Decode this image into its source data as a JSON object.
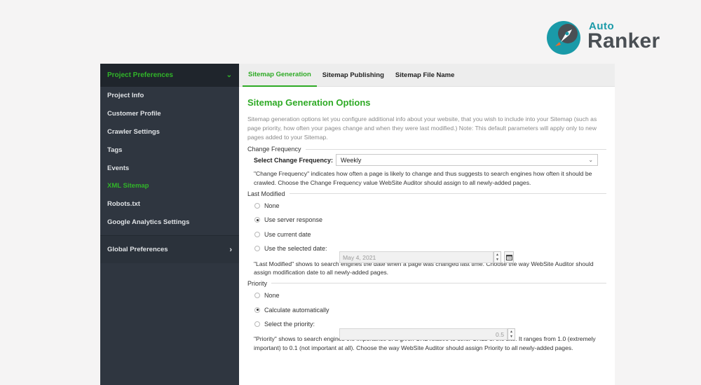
{
  "brand": {
    "line1": "Auto",
    "line2": "Ranker"
  },
  "sidebar": {
    "header": "Project Preferences",
    "items": [
      {
        "label": "Project Info"
      },
      {
        "label": "Customer Profile"
      },
      {
        "label": "Crawler Settings"
      },
      {
        "label": "Tags"
      },
      {
        "label": "Events"
      },
      {
        "label": "XML Sitemap",
        "active": true
      },
      {
        "label": "Robots.txt"
      },
      {
        "label": "Google Analytics Settings"
      }
    ],
    "group": "Global Preferences"
  },
  "tabs": [
    {
      "label": "Sitemap Generation",
      "active": true
    },
    {
      "label": "Sitemap Publishing"
    },
    {
      "label": "Sitemap File Name"
    }
  ],
  "main": {
    "title": "Sitemap Generation Options",
    "description": "Sitemap generation options let you configure additional info about your website, that you wish to include into your Sitemap (such as page priority, how often your pages change and when they were last modified.) Note: This default parameters will apply only to new pages added to your Sitemap.",
    "change_frequency": {
      "section": "Change Frequency",
      "label": "Select Change Frequency:",
      "value": "Weekly",
      "note": "\"Change Frequency\" indicates how often a page is likely to change and thus suggests to search engines how often it should be crawled. Choose the Change Frequency value WebSite Auditor should assign to all newly-added pages."
    },
    "last_modified": {
      "section": "Last Modified",
      "options": [
        "None",
        "Use server response",
        "Use current date",
        "Use the selected date:"
      ],
      "selected": 1,
      "date_value": "May 4, 2021",
      "note": "\"Last Modified\" shows to search engines the date when a page was changed last time. Choose the way WebSite Auditor should assign modification date to all newly-added pages."
    },
    "priority": {
      "section": "Priority",
      "options": [
        "None",
        "Calculate automatically",
        "Select the priority:"
      ],
      "selected": 1,
      "value": "0.5",
      "note": "\"Priority\" shows to search engines the importance of a given URL relative to other URLs of the site. It ranges from 1.0 (extremely important) to 0.1 (not important at all). Choose the way WebSite Auditor should assign Priority to all newly-added pages."
    }
  },
  "colors": {
    "accent": "#2eaa25",
    "sidebar_bg": "#2f3640",
    "brand_teal": "#1a9aa8"
  }
}
